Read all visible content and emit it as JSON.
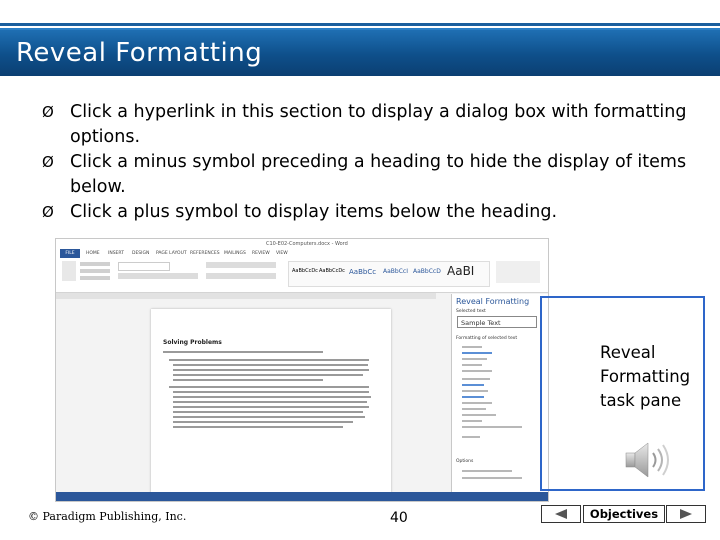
{
  "slide": {
    "title": "Reveal Formatting",
    "bullets": [
      "Click a hyperlink in this section to display a dialog box with formatting options.",
      "Click a minus symbol preceding a heading to hide the display of items below.",
      "Click a plus symbol to display items below the heading."
    ],
    "bullet_marker": "Ø",
    "callout_label": "Reveal Formatting task pane",
    "footer": {
      "copyright": "© Paradigm Publishing, Inc.",
      "page_number": "40",
      "objectives_label": "Objectives"
    }
  },
  "screenshot": {
    "window_title": "C10-E02-Computers.docx - Word",
    "file_tab": "FILE",
    "ribbon_tabs": [
      "HOME",
      "INSERT",
      "DESIGN",
      "PAGE LAYOUT",
      "REFERENCES",
      "MAILINGS",
      "REVIEW",
      "VIEW"
    ],
    "styles": [
      "AaBbCcDc",
      "AaBbCcDc",
      "AaBbCc",
      "AaBbCcI",
      "AaBbCcD",
      "AaBI"
    ],
    "document_heading": "Solving Problems",
    "pane": {
      "title": "Reveal Formatting",
      "selected_text_label": "Selected text",
      "sample_text": "Sample Text",
      "formatting_label": "Formatting of selected text",
      "options_label": "Options"
    }
  },
  "colors": {
    "title_bar": "#0e4f8a",
    "word_blue": "#2b579a",
    "callout_border": "#2e66c9"
  }
}
